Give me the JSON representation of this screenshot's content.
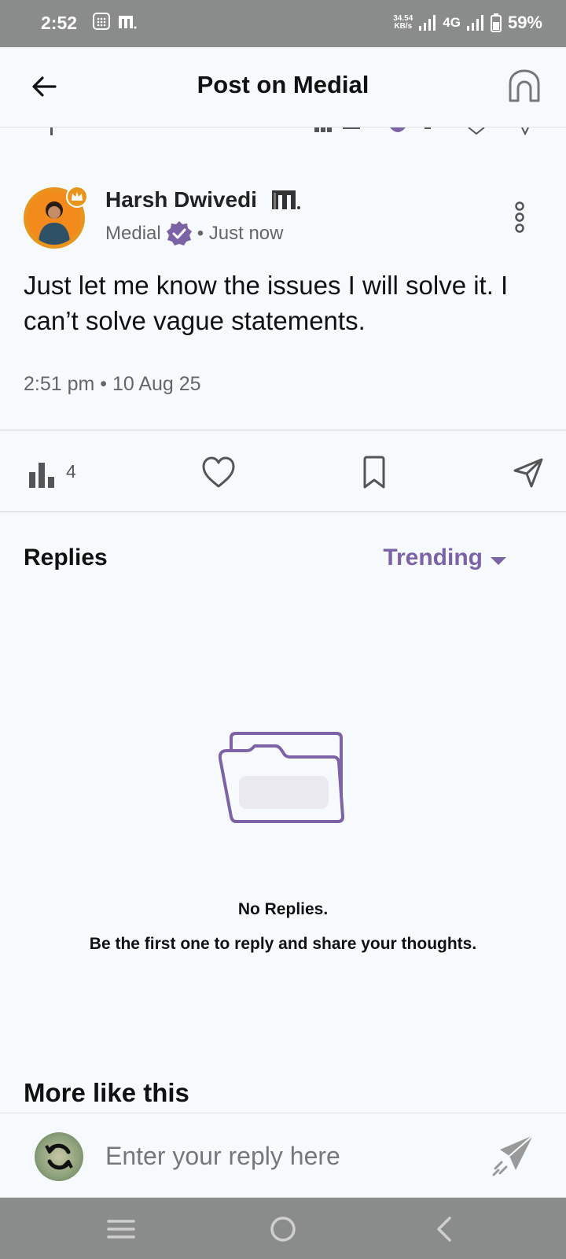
{
  "status_bar": {
    "time": "2:52",
    "net_speed_value": "34.54",
    "net_speed_unit": "KB/s",
    "network": "4G",
    "battery": "59%"
  },
  "header": {
    "title": "Post on Medial"
  },
  "post": {
    "author": "Harsh Dwivedi",
    "platform": "Medial",
    "posted": "• Just now",
    "body": "Just let me know the issues I will solve it. I can’t solve vague statements.",
    "timestamp": "2:51 pm • 10 Aug 25",
    "views": "4"
  },
  "replies": {
    "title": "Replies",
    "sort": "Trending",
    "empty_title": "No Replies.",
    "empty_subtitle": "Be the first one to reply and share your thoughts."
  },
  "more_like_this": "More like this",
  "reply_box": {
    "placeholder": "Enter your reply here"
  },
  "colors": {
    "accent": "#7b63a6",
    "avatar_ring": "#e8941d",
    "status_bar": "#8a8b8b"
  }
}
